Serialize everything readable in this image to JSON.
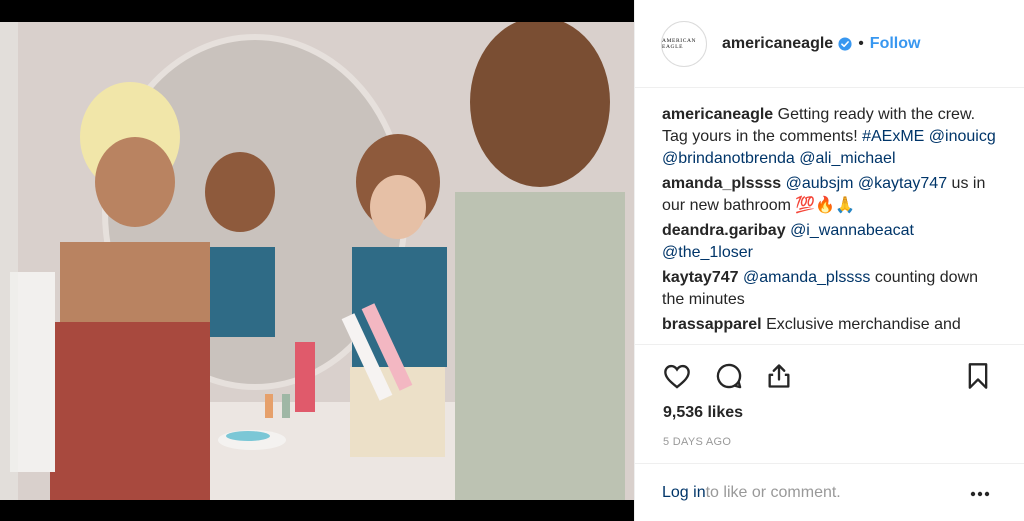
{
  "post": {
    "username": "americaneagle",
    "avatar_text": "AMERICAN EAGLE",
    "verified": true,
    "dot": "•",
    "follow_label": "Follow"
  },
  "comments": [
    {
      "user": "americaneagle",
      "text": "Getting ready with the crew. Tag yours in the comments! ",
      "tags": "#AExME @inouicg @brindanotbrenda @ali_michael"
    },
    {
      "user": "amanda_plssss",
      "tags": "@aubsjm @kaytay747",
      "text": " us in our new bathroom 💯🔥🙏"
    },
    {
      "user": "deandra.garibay",
      "tags": "@i_wannabeacat @the_1loser",
      "text": ""
    },
    {
      "user": "kaytay747",
      "tags": "@amanda_plssss",
      "text": " counting down the minutes"
    },
    {
      "user": "brassapparel",
      "tags": "",
      "text": "Exclusive merchandise and"
    }
  ],
  "actions": {
    "like_icon": "heart-icon",
    "comment_icon": "comment-icon",
    "share_icon": "share-icon",
    "save_icon": "bookmark-icon"
  },
  "likes": "9,536 likes",
  "time": "5 DAYS AGO",
  "footer": {
    "login_label": "Log in",
    "rest": " to like or comment.",
    "more_icon": "more-options-icon"
  },
  "colors": {
    "link": "#003569",
    "follow": "#3897f0",
    "verified": "#3897f0",
    "muted": "#999999"
  }
}
